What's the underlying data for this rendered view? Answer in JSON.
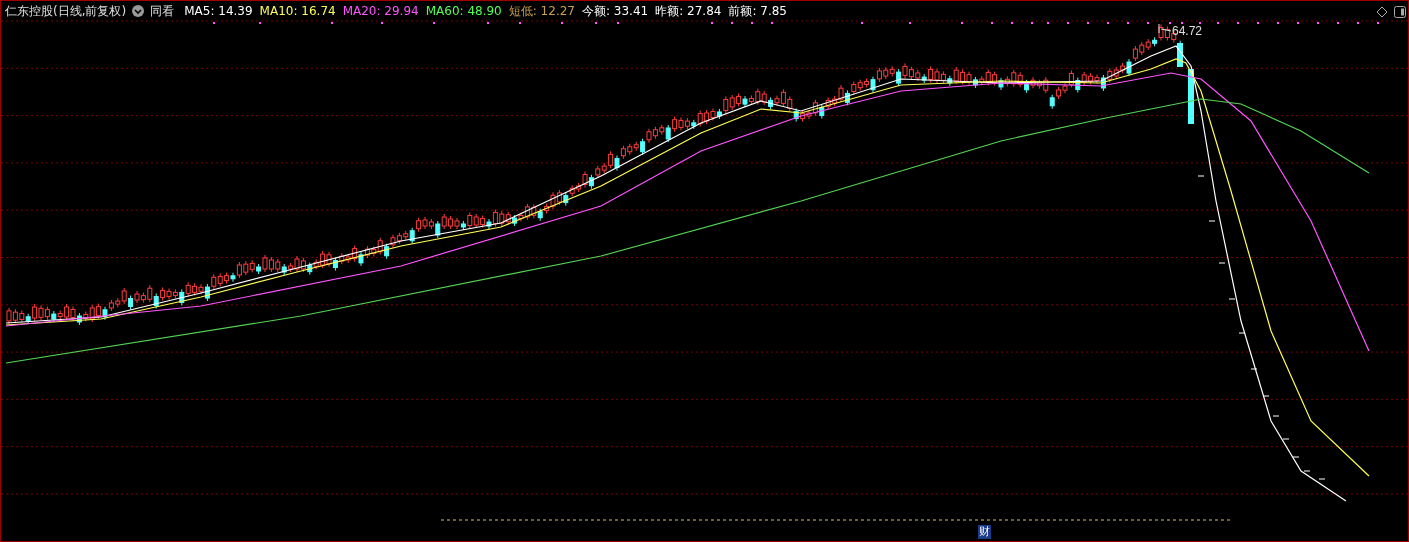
{
  "header": {
    "title": "仁东控股(日线,前复权)",
    "compare_label": "同看",
    "indicators": [
      {
        "kind": "ma5",
        "label": "MA5:",
        "value": "14.39"
      },
      {
        "kind": "ma10",
        "label": "MA10:",
        "value": "16.74"
      },
      {
        "kind": "ma20",
        "label": "MA20:",
        "value": "29.94"
      },
      {
        "kind": "ma60",
        "label": "MA60:",
        "value": "48.90"
      },
      {
        "kind": "low",
        "label": "短低:",
        "value": "12.27"
      },
      {
        "kind": "amount",
        "label": "今额:",
        "value": "33.41"
      },
      {
        "kind": "amount",
        "label": "昨额:",
        "value": "27.84"
      },
      {
        "kind": "amount",
        "label": "前额:",
        "value": "7.85"
      }
    ]
  },
  "chart": {
    "peak_label": "64.72",
    "event_marker": "财"
  }
}
